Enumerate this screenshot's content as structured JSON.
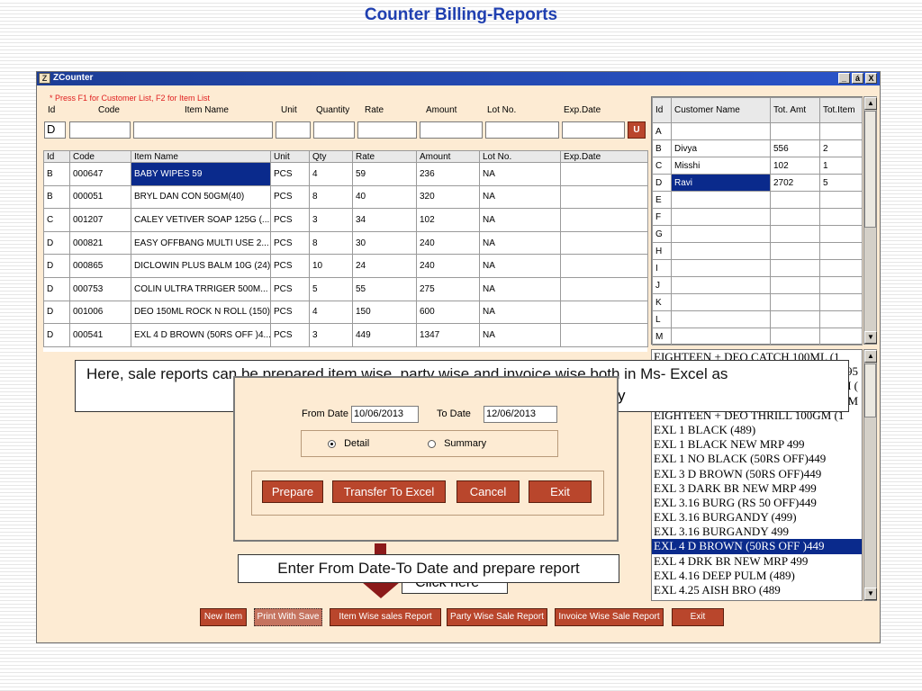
{
  "slide_title": "Counter Billing-Reports",
  "window": {
    "title": "ZCounter",
    "controls": [
      "_",
      "á",
      "X"
    ]
  },
  "entry": {
    "hint": "* Press F1 for Customer List, F2 for Item List",
    "labels": [
      "Id",
      "Code",
      "Item Name",
      "Unit",
      "Quantity",
      "Rate",
      "Amount",
      "Lot No.",
      "Exp.Date"
    ],
    "id_value": "D",
    "u_button": "U"
  },
  "items_table": {
    "columns": [
      "Id",
      "Code",
      "Item Name",
      "Unit",
      "Qty",
      "Rate",
      "Amount",
      "Lot No.",
      "Exp.Date"
    ],
    "rows": [
      [
        "B",
        "000647",
        "BABY WIPES 59",
        "PCS",
        "4",
        "59",
        "236",
        "NA",
        ""
      ],
      [
        "B",
        "000051",
        "BRYL DAN CON 50GM(40)",
        "PCS",
        "8",
        "40",
        "320",
        "NA",
        ""
      ],
      [
        "C",
        "001207",
        "CALEY VETIVER SOAP 125G (...",
        "PCS",
        "3",
        "34",
        "102",
        "NA",
        ""
      ],
      [
        "D",
        "000821",
        "EASY OFFBANG MULTI USE 2...",
        "PCS",
        "8",
        "30",
        "240",
        "NA",
        ""
      ],
      [
        "D",
        "000865",
        "DICLOWIN PLUS BALM 10G (24)",
        "PCS",
        "10",
        "24",
        "240",
        "NA",
        ""
      ],
      [
        "D",
        "000753",
        "COLIN ULTRA TRRIGER 500M...",
        "PCS",
        "5",
        "55",
        "275",
        "NA",
        ""
      ],
      [
        "D",
        "001006",
        "DEO 150ML ROCK N ROLL (150)",
        "PCS",
        "4",
        "150",
        "600",
        "NA",
        ""
      ],
      [
        "D",
        "000541",
        "EXL 4 D BROWN (50RS OFF )4...",
        "PCS",
        "3",
        "449",
        "1347",
        "NA",
        ""
      ]
    ]
  },
  "customer_table": {
    "columns": [
      "Id",
      "Customer Name",
      "Tot. Amt",
      "Tot.Item"
    ],
    "rows": [
      [
        "A",
        "",
        "",
        ""
      ],
      [
        "B",
        "Divya",
        "556",
        "2"
      ],
      [
        "C",
        "Misshi",
        "102",
        "1"
      ],
      [
        "D",
        "Ravi",
        "2702",
        "5"
      ],
      [
        "E",
        "",
        "",
        ""
      ],
      [
        "F",
        "",
        "",
        ""
      ],
      [
        "G",
        "",
        "",
        ""
      ],
      [
        "H",
        "",
        "",
        ""
      ],
      [
        "I",
        "",
        "",
        ""
      ],
      [
        "J",
        "",
        "",
        ""
      ],
      [
        "K",
        "",
        "",
        ""
      ],
      [
        "L",
        "",
        "",
        ""
      ],
      [
        "M",
        "",
        "",
        ""
      ]
    ]
  },
  "item_list": [
    "EIGHTEEN + DEO CATCH 100ML (1",
    "95",
    "M (",
    "M",
    "EIGHTEEN + DEO THRILL 100GM (1",
    "EXL 1 BLACK (489)",
    "EXL 1 BLACK NEW MRP 499",
    "EXL 1 NO BLACK (50RS OFF)449",
    "EXL 3 D BROWN (50RS OFF)449",
    "EXL 3 DARK BR NEW MRP 499",
    "EXL 3.16 BURG (RS 50 OFF)449",
    "EXL 3.16 BURGANDY (499)",
    "EXL 3.16 BURGANDY 499",
    "EXL 4 D BROWN (50RS OFF )449",
    "EXL 4 DRK BR NEW MRP 499",
    "EXL 4.16 DEEP PULM (489)",
    "EXL 4.25 AISH BRO (489"
  ],
  "callout_top": "Here, sale reports can be prepared item wise, party wise and invoice wise both in Ms- Excel as",
  "callout_top_tail": "y",
  "callout_bottom": "Enter From Date-To Date and prepare report",
  "hidden_note": "Click here",
  "dialog": {
    "from_label": "From Date",
    "from_value": "10/06/2013",
    "to_label": "To Date",
    "to_value": "12/06/2013",
    "detail_label": "Detail",
    "summary_label": "Summary",
    "buttons": [
      "Prepare",
      "Transfer To Excel",
      "Cancel",
      "Exit"
    ]
  },
  "bottom_buttons": [
    "New Item",
    "Print With Save",
    "Item Wise sales Report",
    "Party Wise Sale Report",
    "Invoice Wise Sale Report",
    "Exit"
  ]
}
